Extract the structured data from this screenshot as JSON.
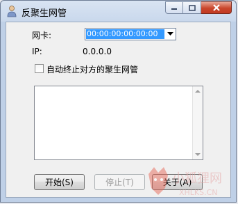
{
  "window": {
    "title": "反聚生网管"
  },
  "form": {
    "nic_label": "网卡:",
    "nic_value": "00:00:00:00:00:00",
    "ip_label": "IP:",
    "ip_value": "0.0.0.0",
    "auto_stop_label": "自动终止对方的聚生网管",
    "auto_stop_checked": false
  },
  "buttons": {
    "start": "开始(S)",
    "stop": "停止(T)",
    "about": "关于(A)"
  },
  "watermark": {
    "text": "小狐狸网",
    "url": "XHLKS.CN"
  },
  "colors": {
    "selection": "#3399ff",
    "close_button": "#c9462c"
  }
}
